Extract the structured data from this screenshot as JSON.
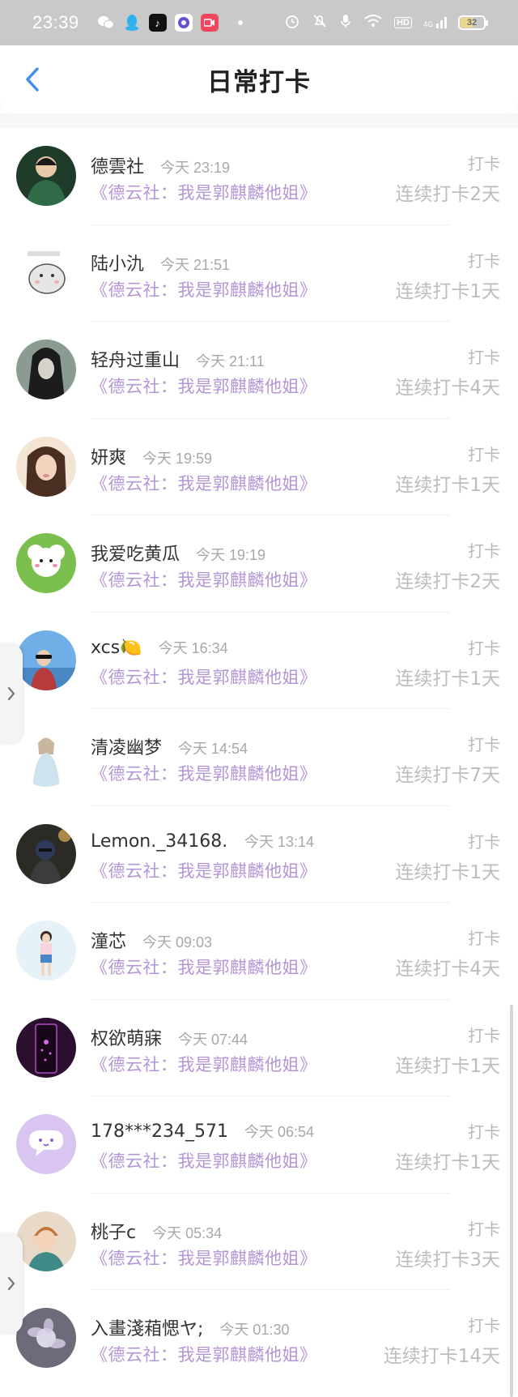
{
  "status_bar": {
    "time": "23:39",
    "battery": "32",
    "network": "4G",
    "hd": "HD"
  },
  "header": {
    "title": "日常打卡"
  },
  "colors": {
    "accent": "#3a8ff0",
    "book_title": "#b495d6",
    "status_bar_bg": "#c9c9c9"
  },
  "entries": [
    {
      "name": "德雲社",
      "time": "今天 23:19",
      "label": "打卡",
      "book": "《德云社：我是郭麒麟他姐》",
      "streak": "连续打卡2天"
    },
    {
      "name": "陆小氿",
      "time": "今天 21:51",
      "label": "打卡",
      "book": "《德云社：我是郭麒麟他姐》",
      "streak": "连续打卡1天"
    },
    {
      "name": "轻舟过重山",
      "time": "今天 21:11",
      "label": "打卡",
      "book": "《德云社：我是郭麒麟他姐》",
      "streak": "连续打卡4天"
    },
    {
      "name": "妍爽",
      "time": "今天 19:59",
      "label": "打卡",
      "book": "《德云社：我是郭麒麟他姐》",
      "streak": "连续打卡1天"
    },
    {
      "name": "我爱吃黄瓜",
      "time": "今天 19:19",
      "label": "打卡",
      "book": "《德云社：我是郭麒麟他姐》",
      "streak": "连续打卡2天"
    },
    {
      "name": "xcs🍋",
      "time": "今天 16:34",
      "label": "打卡",
      "book": "《德云社：我是郭麒麟他姐》",
      "streak": "连续打卡1天"
    },
    {
      "name": "清凌幽梦",
      "time": "今天 14:54",
      "label": "打卡",
      "book": "《德云社：我是郭麒麟他姐》",
      "streak": "连续打卡7天"
    },
    {
      "name": "Lemon._34168...",
      "time": "今天 13:14",
      "label": "打卡",
      "book": "《德云社：我是郭麒麟他姐》",
      "streak": "连续打卡1天"
    },
    {
      "name": "潼芯",
      "time": "今天 09:03",
      "label": "打卡",
      "book": "《德云社：我是郭麒麟他姐》",
      "streak": "连续打卡4天"
    },
    {
      "name": "权欲萌寐",
      "time": "今天 07:44",
      "label": "打卡",
      "book": "《德云社：我是郭麒麟他姐》",
      "streak": "连续打卡1天"
    },
    {
      "name": "178***234_571...",
      "time": "今天 06:54",
      "label": "打卡",
      "book": "《德云社：我是郭麒麟他姐》",
      "streak": "连续打卡1天"
    },
    {
      "name": "桃子c",
      "time": "今天 05:34",
      "label": "打卡",
      "book": "《德云社：我是郭麒麟他姐》",
      "streak": "连续打卡3天"
    },
    {
      "name": "入畫淺葙愢ヤ;",
      "time": "今天 01:30",
      "label": "打卡",
      "book": "《德云社：我是郭麒麟他姐》",
      "streak": "连续打卡14天"
    }
  ]
}
